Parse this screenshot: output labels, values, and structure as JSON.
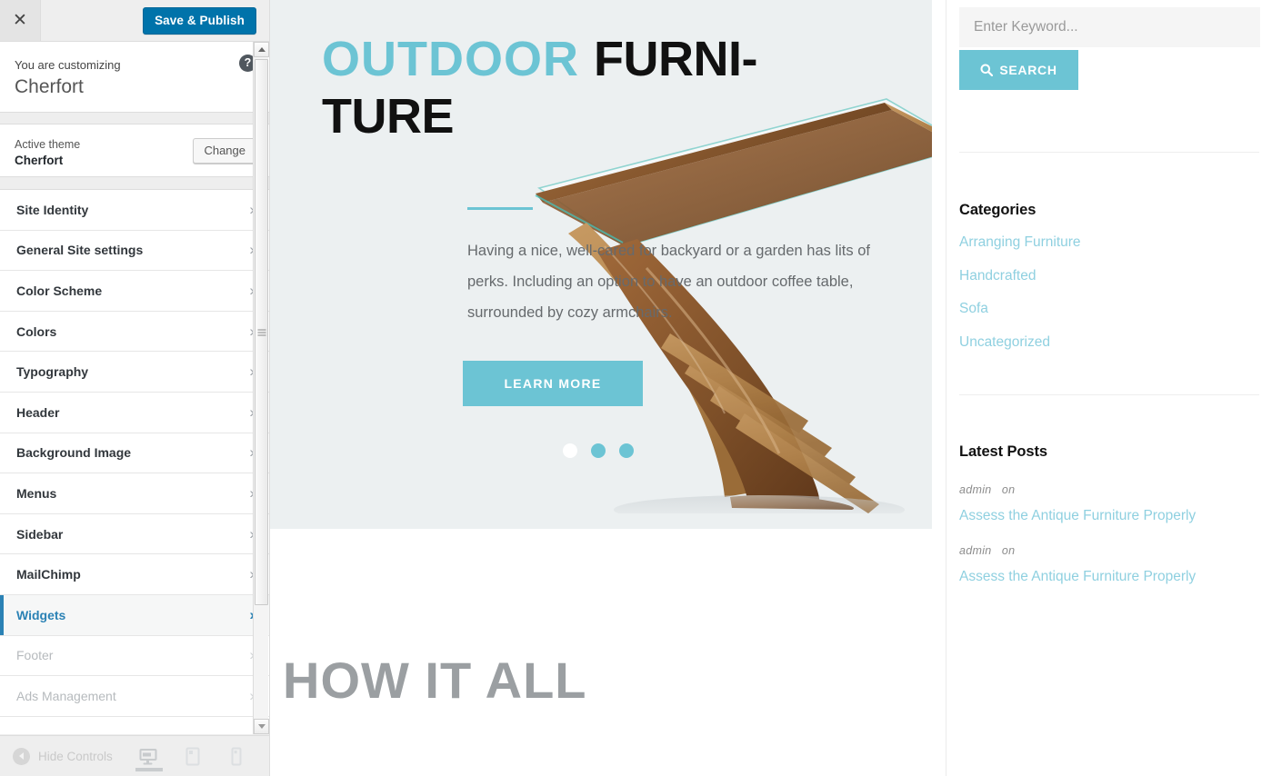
{
  "customizer": {
    "close_icon": "close-icon",
    "save_label": "Save & Publish",
    "help_icon": "?",
    "customizing_label": "You are customizing",
    "site_title": "Cherfort",
    "active_theme_label": "Active theme",
    "active_theme_name": "Cherfort",
    "change_label": "Change",
    "accent_color": "#0073aa",
    "active_item_color": "#2b82b5",
    "items": [
      {
        "label": "Site Identity",
        "state": "normal"
      },
      {
        "label": "General Site settings",
        "state": "normal"
      },
      {
        "label": "Color Scheme",
        "state": "normal"
      },
      {
        "label": "Colors",
        "state": "normal"
      },
      {
        "label": "Typography",
        "state": "normal"
      },
      {
        "label": "Header",
        "state": "normal"
      },
      {
        "label": "Background Image",
        "state": "normal"
      },
      {
        "label": "Menus",
        "state": "normal"
      },
      {
        "label": "Sidebar",
        "state": "normal"
      },
      {
        "label": "MailChimp",
        "state": "normal"
      },
      {
        "label": "Widgets",
        "state": "active"
      },
      {
        "label": "Footer",
        "state": "dim"
      },
      {
        "label": "Ads Management",
        "state": "dim"
      }
    ],
    "footer": {
      "hide_controls_label": "Hide Controls",
      "devices": [
        "desktop",
        "tablet",
        "mobile"
      ],
      "active_device": "desktop"
    }
  },
  "preview": {
    "hero": {
      "title_part1": "OUTDOOR ",
      "title_part2": "FURNI-TURE",
      "title_accent_color": "#6cc4d4",
      "body": "Having a nice, well-cared for backyard or a garden has lits of perks. Including an option to have an outdoor coffee table, surrounded by cozy armchairs.",
      "button_label": "LEARN MORE",
      "slider_dots": 3,
      "active_dot": 1,
      "background_color": "#ecf0f1"
    },
    "section_heading": "HOW IT ALL",
    "widgets": {
      "search": {
        "placeholder": "Enter Keyword...",
        "value": "",
        "button_label": "SEARCH",
        "button_icon": "search-icon"
      },
      "categories": {
        "title": "Categories",
        "items": [
          "Arranging Furniture",
          "Handcrafted",
          "Sofa",
          "Uncategorized"
        ]
      },
      "latest_posts": {
        "title": "Latest Posts",
        "items": [
          {
            "author": "admin",
            "connector": "on",
            "title": "Assess the Antique Furniture Properly"
          },
          {
            "author": "admin",
            "connector": "on",
            "title": "Assess the Antique Furniture Properly"
          }
        ]
      }
    }
  }
}
